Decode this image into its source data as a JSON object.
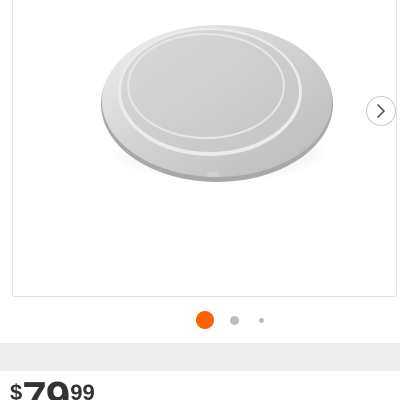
{
  "product": {
    "image_icon": "round-stainless-steel-lid-image",
    "next_icon": "chevron-right-icon"
  },
  "carousel": {
    "slide_count": 3,
    "active_index": 0,
    "active_color": "#f96302",
    "inactive_color": "#bdbdbd"
  },
  "price": {
    "currency": "$",
    "whole": "79",
    "cents": "99"
  }
}
